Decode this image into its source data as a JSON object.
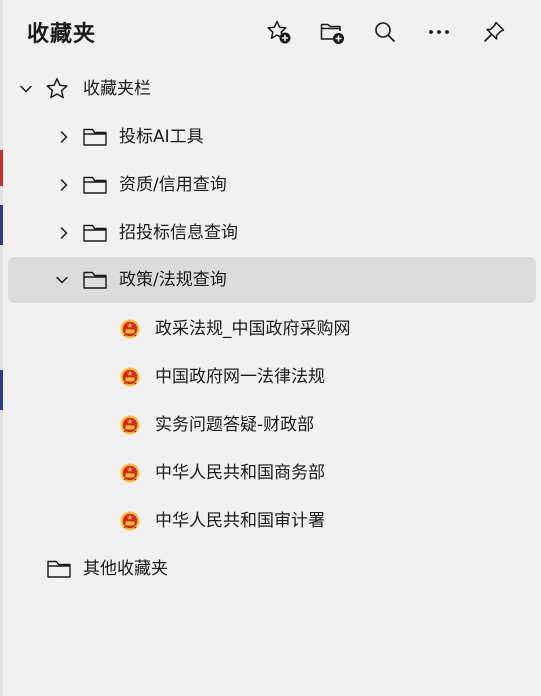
{
  "header": {
    "title": "收藏夹"
  },
  "tree": {
    "root": {
      "label": "收藏夹栏",
      "folders": [
        {
          "label": "投标AI工具"
        },
        {
          "label": "资质/信用查询"
        },
        {
          "label": "招投标信息查询"
        },
        {
          "label": "政策/法规查询",
          "items": [
            {
              "label": "政采法规_中国政府采购网"
            },
            {
              "label": "中国政府网一法律法规"
            },
            {
              "label": "实务问题答疑-财政部"
            },
            {
              "label": "中华人民共和国商务部"
            },
            {
              "label": "中华人民共和国审计署"
            }
          ]
        }
      ]
    },
    "other": {
      "label": "其他收藏夹"
    }
  },
  "icons": {
    "toolbar": [
      "add-favorite-icon",
      "add-folder-icon",
      "search-icon",
      "more-icon",
      "pin-icon"
    ],
    "tree": [
      "chevron-down-icon",
      "chevron-right-icon",
      "star-icon",
      "folder-icon",
      "national-emblem-icon"
    ]
  },
  "colors": {
    "background": "#f1f1f1",
    "selected_row": "#dcdcdc",
    "text": "#1b1b1b",
    "emblem_red": "#d3261f",
    "emblem_gold": "#f2c12e"
  }
}
